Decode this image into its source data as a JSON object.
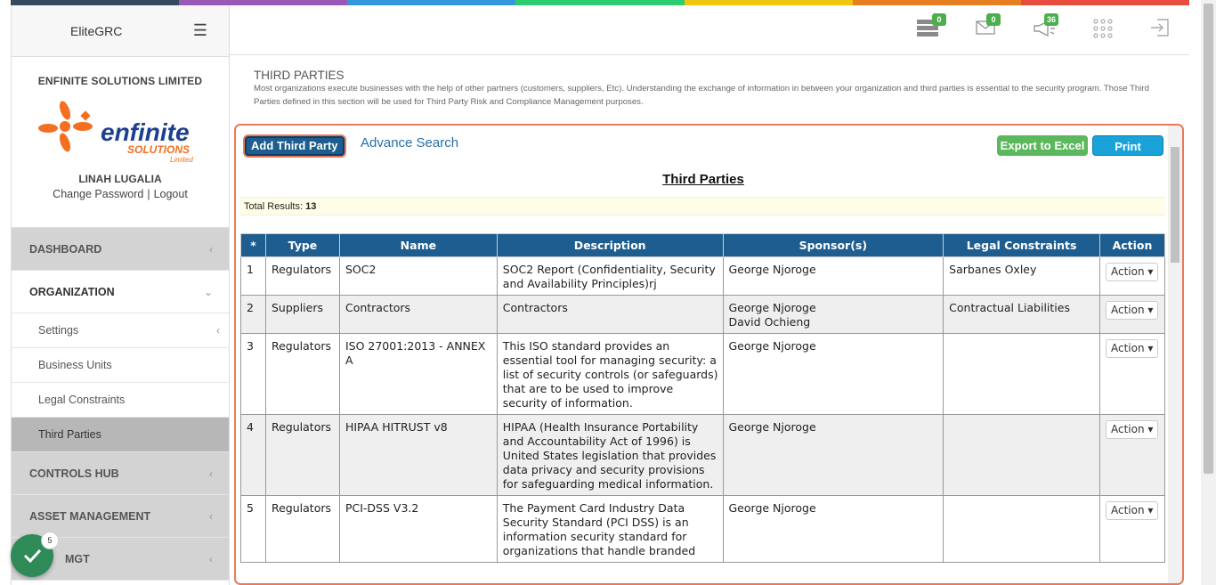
{
  "topbar_colors": [
    "#34495e",
    "#9b59b6",
    "#3498db",
    "#2ecc71",
    "#f1c40f",
    "#e67e22",
    "#e74c3c"
  ],
  "app": {
    "title": "EliteGRC"
  },
  "org": {
    "name": "ENFINITE SOLUTIONS LIMITED",
    "logo_text": "enfinite",
    "logo_sub": "SOLUTIONS",
    "logo_tag": "Limited"
  },
  "user": {
    "name": "LINAH LUGALIA",
    "change_password": "Change Password",
    "separator": "|",
    "logout": "Logout"
  },
  "nav": {
    "dashboard": "DASHBOARD",
    "organization": "ORGANIZATION",
    "settings": "Settings",
    "business_units": "Business Units",
    "legal_constraints": "Legal Constraints",
    "third_parties": "Third Parties",
    "controls_hub": "CONTROLS HUB",
    "asset_management": "ASSET MANAGEMENT",
    "risk_mgt": "MGT"
  },
  "header": {
    "badge_servers": "0",
    "badge_mail": "0",
    "badge_announce": "36"
  },
  "page": {
    "title": "THIRD PARTIES",
    "description": "Most organizations execute businesses with the help of other partners (customers, suppliers, Etc). Understanding the exchange of information in between your organization and third parties is essential to the security program. Those Third Parties defined in this section will be used for Third Party Risk and Compliance Management purposes."
  },
  "toolbar": {
    "add_label": "Add Third Party",
    "advance_search": "Advance Search",
    "export_label": "Export to Excel",
    "print_label": "Print"
  },
  "table": {
    "title": "Third Parties",
    "total_label": "Total Results:",
    "total_value": "13",
    "columns": [
      "*",
      "Type",
      "Name",
      "Description",
      "Sponsor(s)",
      "Legal Constraints",
      "Action"
    ],
    "rows": [
      {
        "num": "1",
        "type": "Regulators",
        "name": "SOC2",
        "description": "SOC2 Report (Confidentiality, Security and Availability Principles)rj",
        "sponsors": "George Njoroge",
        "legal": "Sarbanes Oxley",
        "action": "Action"
      },
      {
        "num": "2",
        "type": "Suppliers",
        "name": "Contractors",
        "description": "Contractors",
        "sponsors": "George Njoroge\nDavid Ochieng",
        "legal": "Contractual Liabilities",
        "action": "Action"
      },
      {
        "num": "3",
        "type": "Regulators",
        "name": "ISO 27001:2013 - ANNEX A",
        "description": "This ISO standard provides an essential tool for managing security: a list of security controls (or safeguards) that are to be used to improve security of information.",
        "sponsors": "George Njoroge",
        "legal": "",
        "action": "Action"
      },
      {
        "num": "4",
        "type": "Regulators",
        "name": "HIPAA HITRUST v8",
        "description": "HIPAA (Health Insurance Portability and Accountability Act of 1996) is United States legislation that provides data privacy and security provisions for safeguarding medical information.",
        "sponsors": "George Njoroge",
        "legal": "",
        "action": "Action"
      },
      {
        "num": "5",
        "type": "Regulators",
        "name": "PCI-DSS V3.2",
        "description": "The Payment Card Industry Data Security Standard (PCI DSS) is an information security standard for organizations that handle branded",
        "sponsors": "George Njoroge",
        "legal": "",
        "action": "Action"
      }
    ]
  },
  "fab": {
    "count": "5"
  }
}
